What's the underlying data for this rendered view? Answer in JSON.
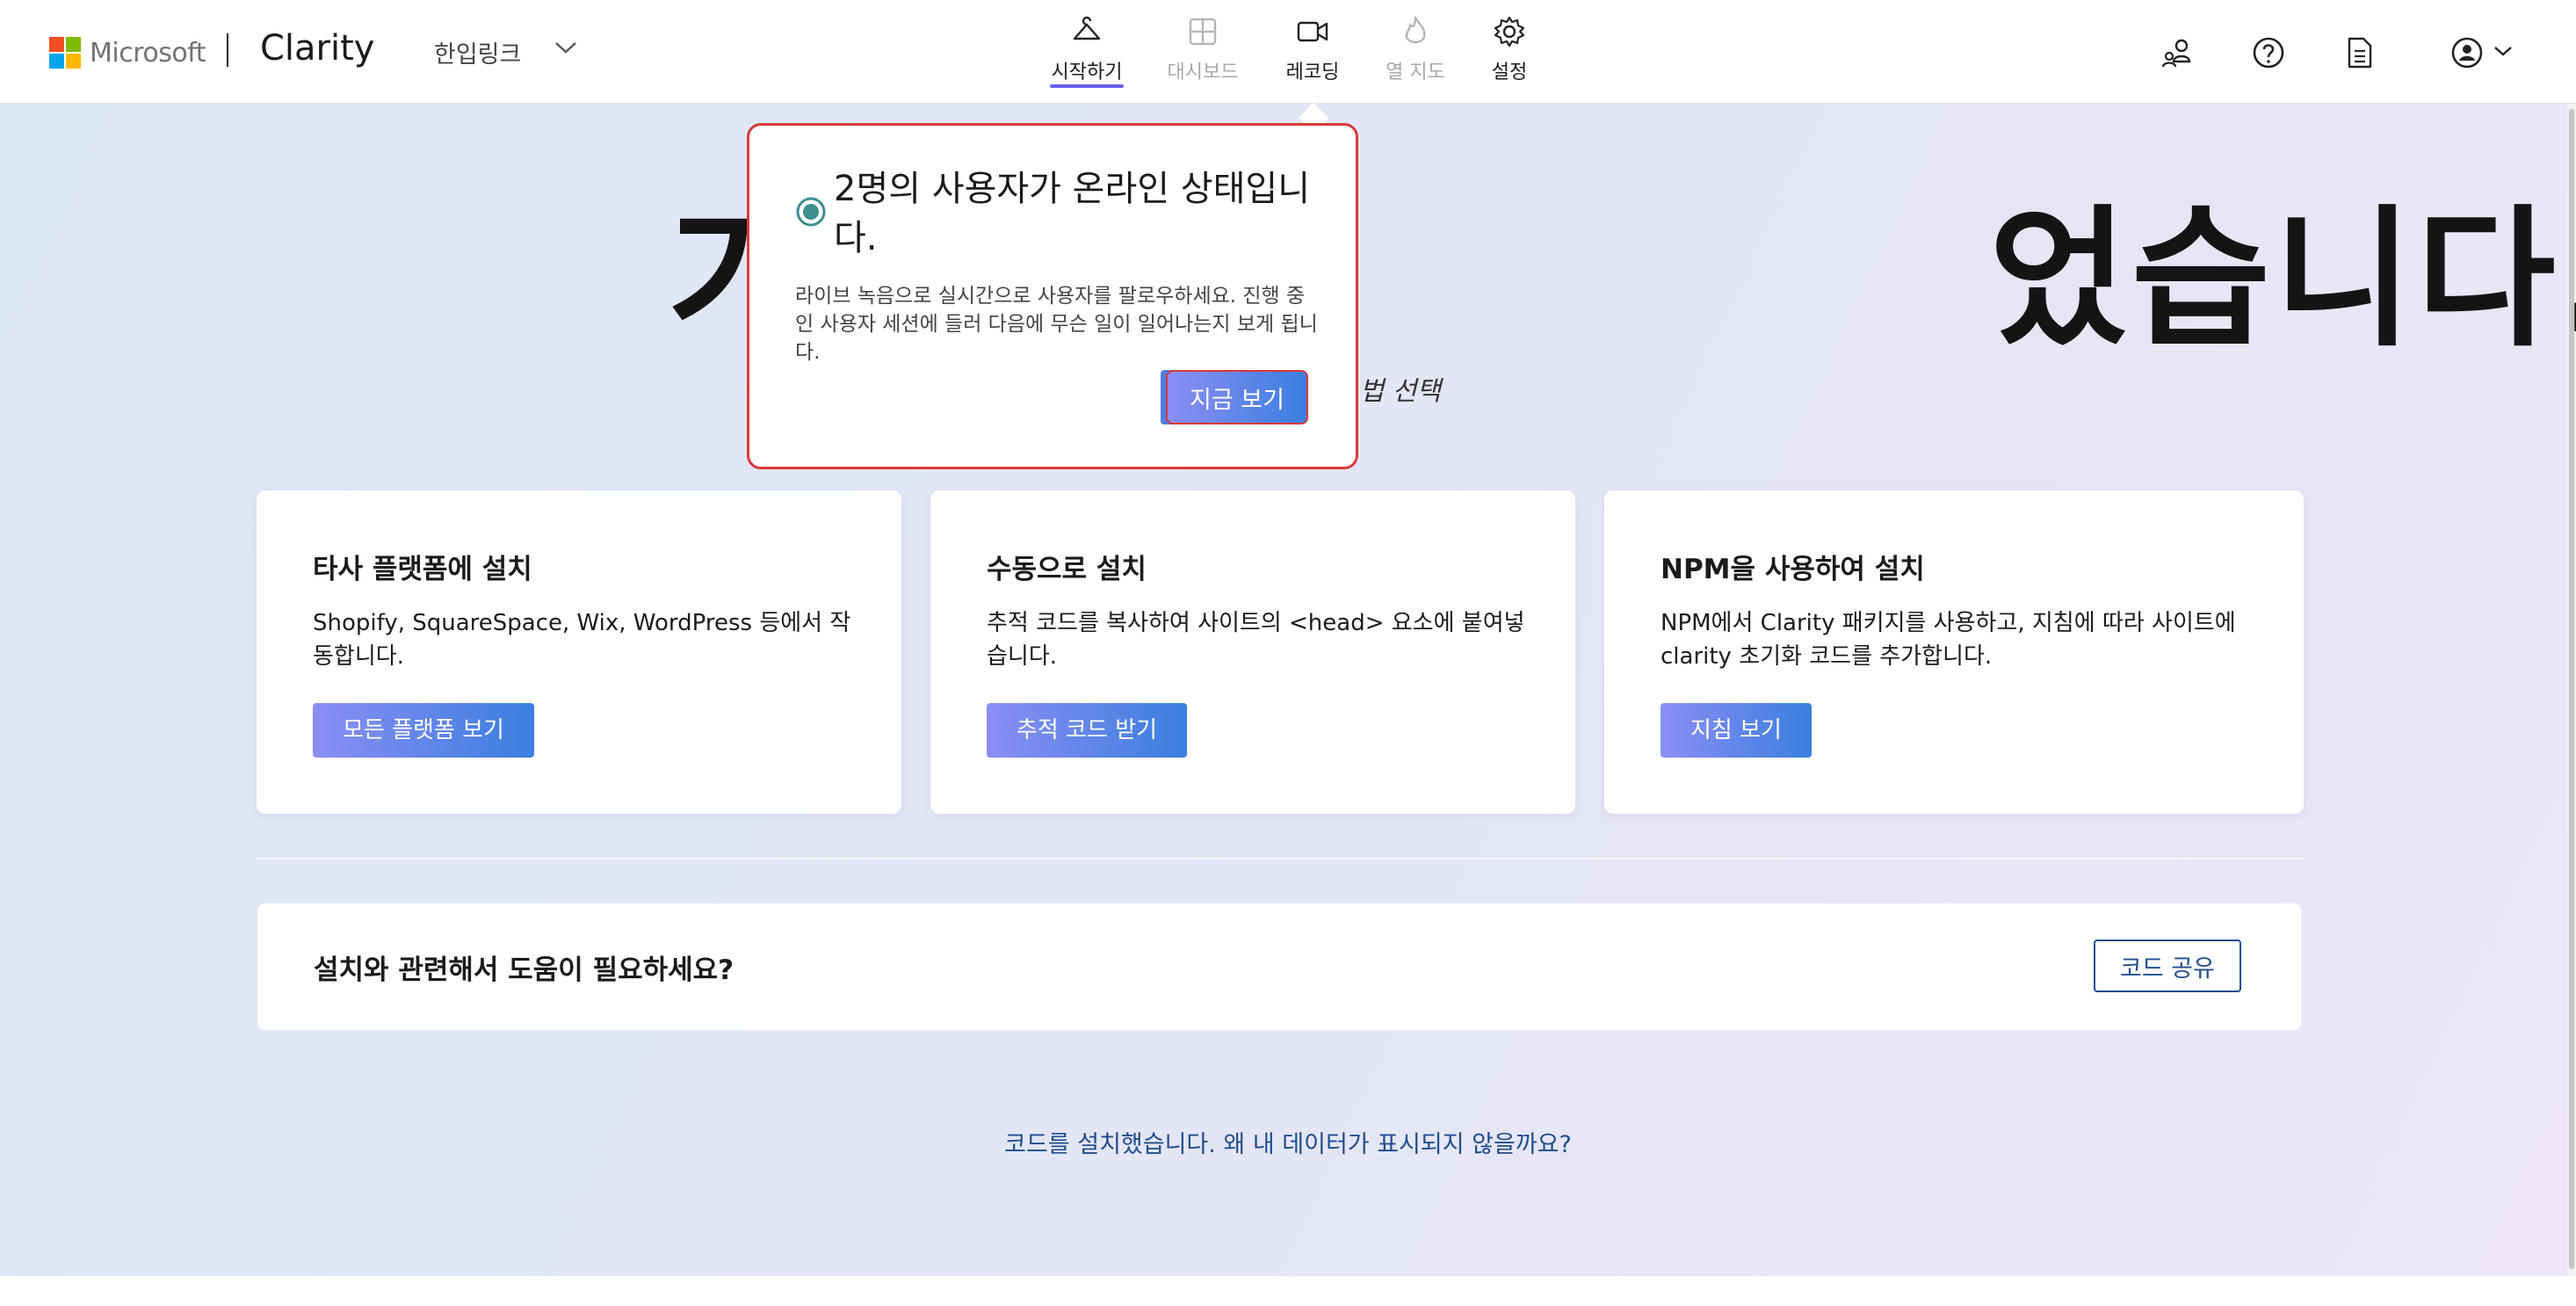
{
  "header": {
    "ms_word": "Microsoft",
    "brand": "Clarity",
    "project_name": "한입링크",
    "nav": [
      {
        "label": "시작하기",
        "icon": "hanger-icon",
        "active": true
      },
      {
        "label": "대시보드",
        "icon": "dashboard-icon",
        "disabled": true
      },
      {
        "label": "레코딩",
        "icon": "video-camera-icon"
      },
      {
        "label": "열 지도",
        "icon": "flame-icon",
        "disabled": true
      },
      {
        "label": "설정",
        "icon": "gear-icon"
      }
    ],
    "right_icons": [
      "team-icon",
      "help-icon",
      "document-icon",
      "account-icon"
    ],
    "ms_colors": [
      "#f25022",
      "#7fba00",
      "#00a4ef",
      "#ffb900"
    ]
  },
  "hero": {
    "title_visible": "가                     었습니다.",
    "subtitle": "법 선택"
  },
  "cards": [
    {
      "title": "타사 플랫폼에 설치",
      "desc": "Shopify, SquareSpace, Wix, WordPress 등에서 작동합니다.",
      "button": "모든 플랫폼 보기"
    },
    {
      "title": "수동으로 설치",
      "desc": "추적 코드를 복사하여 사이트의 <head> 요소에 붙여넣습니다.",
      "button": "추적 코드 받기"
    },
    {
      "title": "NPM을 사용하여 설치",
      "desc": "NPM에서 Clarity 패키지를 사용하고, 지침에 따라 사이트에 clarity 초기화 코드를 추가합니다.",
      "button": "지침 보기"
    }
  ],
  "help": {
    "title": "설치와 관련해서 도움이 필요하세요?",
    "share_button": "코드 공유"
  },
  "bottom_link": "코드를 설치했습니다. 왜 내 데이터가 표시되지 않을까요?",
  "popup": {
    "title": "2명의 사용자가 온라인 상태입니다.",
    "body": "라이브 녹음으로 실시간으로 사용자를 팔로우하세요. 진행 중인 사용자 세션에 들러 다음에 무슨 일이 일어나는지 보게 됩니다.",
    "button": "지금 보기"
  }
}
